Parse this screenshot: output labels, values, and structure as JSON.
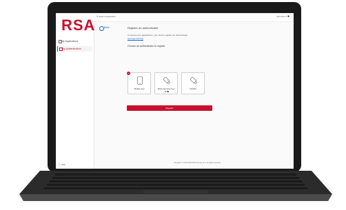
{
  "brand": {
    "logo": "RSA",
    "accent": "#c8102e",
    "link": "#1a63c1"
  },
  "sidebar": {
    "items": [
      {
        "label": "My Applications",
        "icon": "grid-icon"
      },
      {
        "label": "My Authenticators",
        "icon": "key-icon"
      }
    ],
    "help_label": "Help"
  },
  "topbar": {
    "search_placeholder": "Search application",
    "user_label": "John Doe"
  },
  "main": {
    "back_label": "Back",
    "heading": "Register an authenticator",
    "intro": "To access your applications, you need to register an authenticator.",
    "intro_link": "Get help with this",
    "choose_label": "Choose an authenticator to register",
    "cards": [
      {
        "label": "Mobile App",
        "icon": "phone-icon"
      },
      {
        "label": "FIDO Security Key",
        "icon": "usb-key-icon"
      },
      {
        "label": "DS100",
        "icon": "usb-key-icon"
      }
    ],
    "register_label": "Register"
  },
  "footer": {
    "text": "Copyright © 2022-2023 RSA Security LLC. All rights reserved."
  }
}
